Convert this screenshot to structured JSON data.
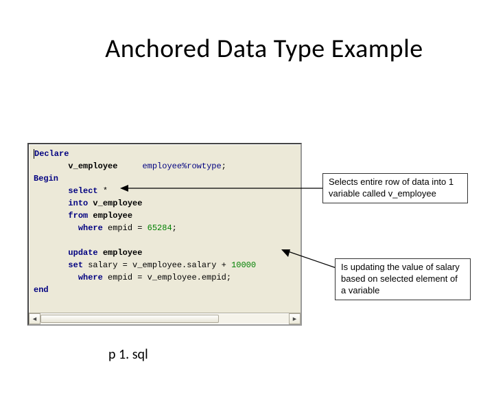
{
  "title": "Anchored Data Type Example",
  "caption": "p 1. sql",
  "callouts": {
    "c1": "Selects entire row of data into 1 variable called v_employee",
    "c2": "Is updating the value of salary based on selected element of a variable"
  },
  "code": {
    "l1_kw": "Declare",
    "l2_var": "v_employee",
    "l2_type": "employee%rowtype",
    "l2_semi": ";",
    "l3_kw": "Begin",
    "l4_sel": "select",
    "l4_star": " *",
    "l5_into": "into",
    "l5_var": " v_employee",
    "l6_from": "from",
    "l6_tbl": " employee",
    "l7_where": "where",
    "l7_cond": " empid = ",
    "l7_num": "65284",
    "l7_semi": ";",
    "l8_upd": "update",
    "l8_tbl": " employee",
    "l9_set": "set",
    "l9_expr": " salary = v_employee.salary + ",
    "l9_num": "10000",
    "l10_where": "where",
    "l10_cond": " empid = v_employee.empid;",
    "l11_end": "end"
  }
}
